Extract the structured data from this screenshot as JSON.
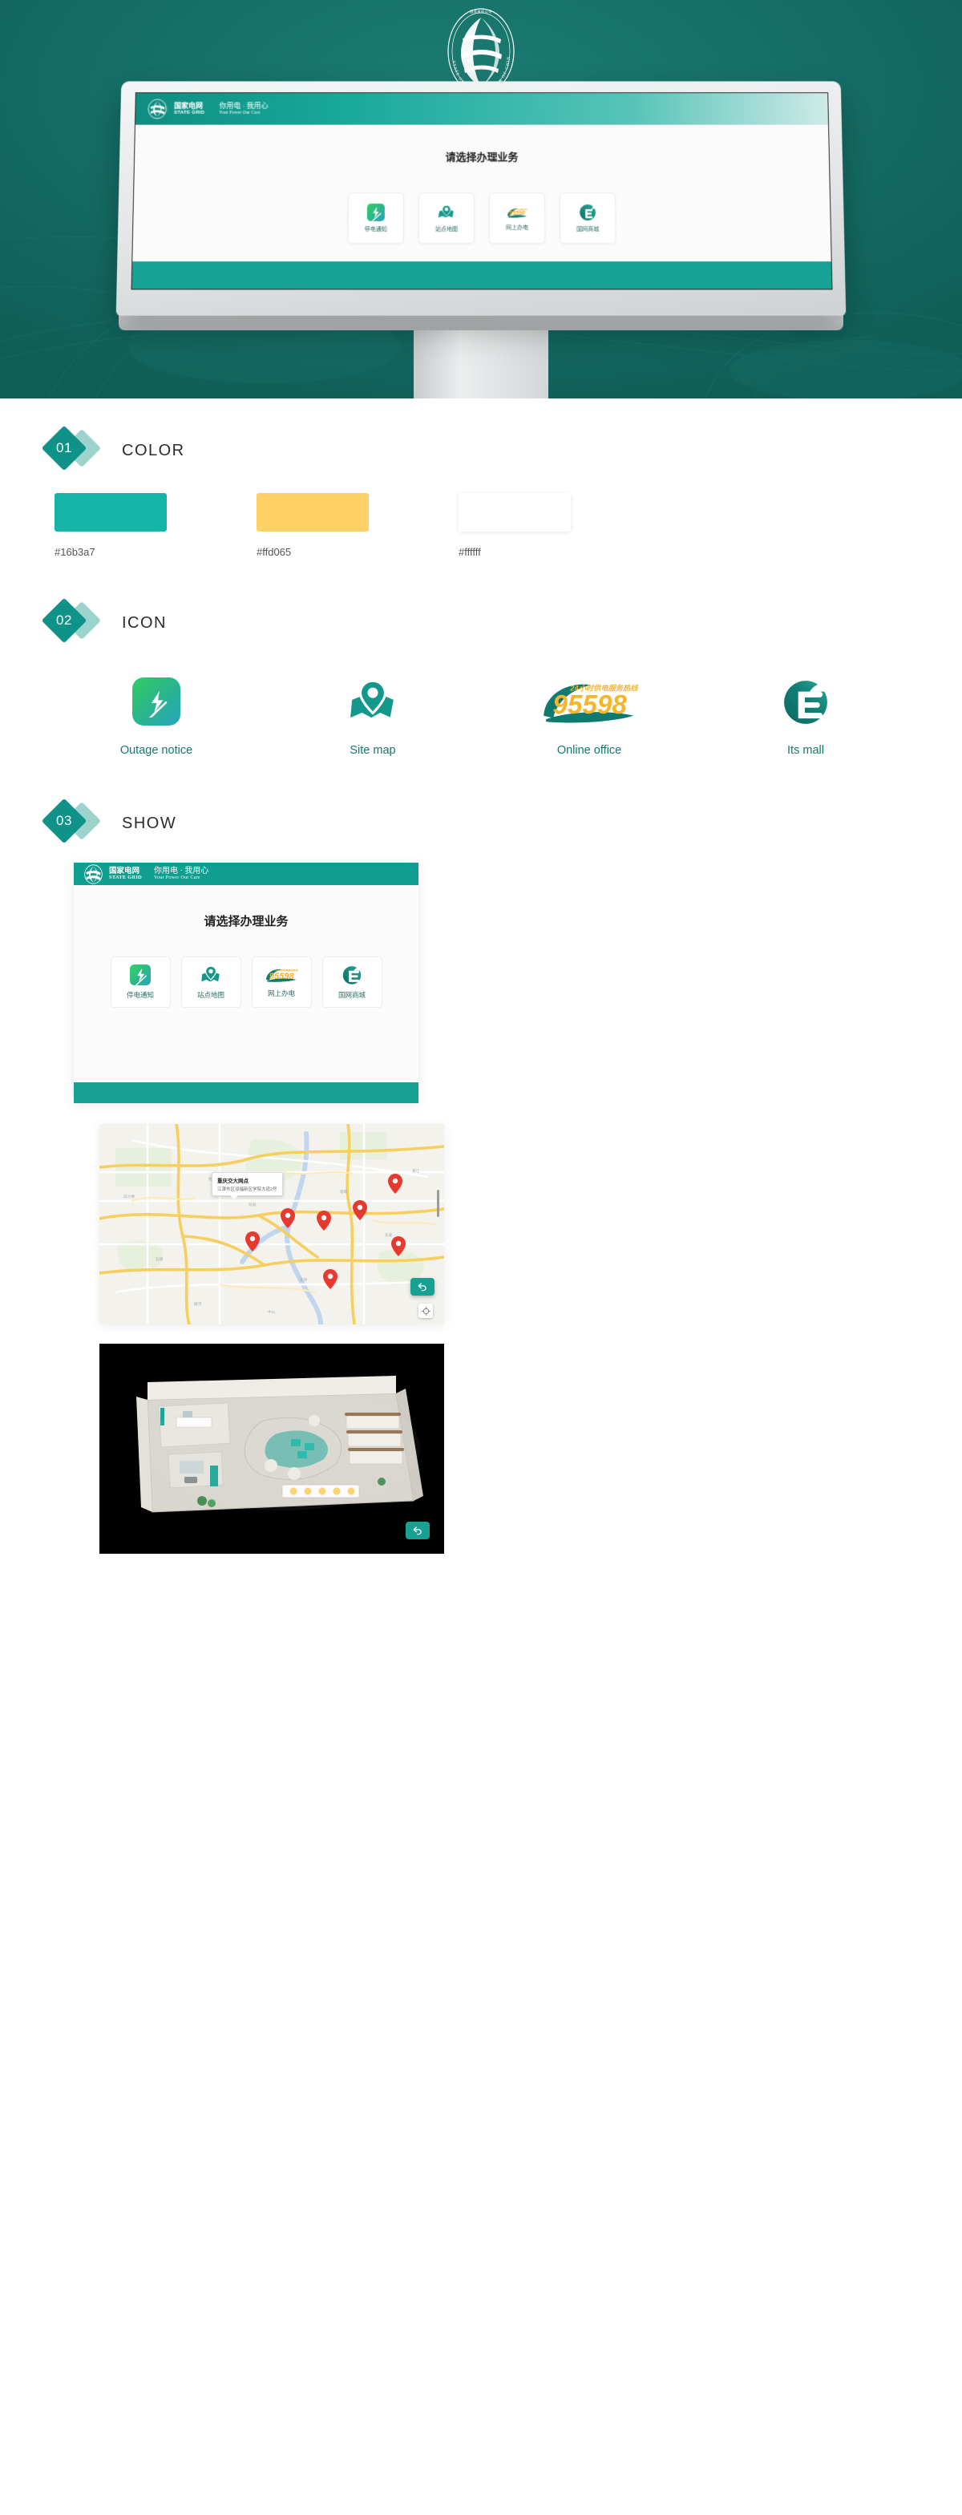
{
  "hero": {
    "brand_cn": "国家电网公司",
    "brand_en": "STATE GRID",
    "brand_en_parts": {
      "s": "S",
      "tate": "TATE",
      "g": "G",
      "rid": "RID"
    },
    "kiosk": {
      "header_cn": "国家电网",
      "header_en": "STATE GRID",
      "slogan_cn": "你用电 · 我用心",
      "slogan_en": "Your Power Our Care",
      "title": "请选择办理业务",
      "buttons": [
        {
          "label": "停电通知",
          "icon": "outage-notice-icon"
        },
        {
          "label": "站点地图",
          "icon": "site-map-icon"
        },
        {
          "label": "网上办电",
          "icon": "online-office-95598-icon"
        },
        {
          "label": "国网商城",
          "icon": "its-mall-e-icon"
        }
      ]
    }
  },
  "sections": [
    {
      "number": "01",
      "title": "COLOR"
    },
    {
      "number": "02",
      "title": "ICON"
    },
    {
      "number": "03",
      "title": "SHOW"
    }
  ],
  "color_section": {
    "swatches": [
      {
        "hex": "#16b3a7",
        "label": "#16b3a7"
      },
      {
        "hex": "#ffd065",
        "label": "#ffd065"
      },
      {
        "hex": "#ffffff",
        "label": "#ffffff"
      }
    ]
  },
  "icon_section": {
    "icons": [
      {
        "name": "outage-notice-icon",
        "label": "Outage notice"
      },
      {
        "name": "site-map-icon",
        "label": "Site map"
      },
      {
        "name": "online-office-icon",
        "label": "Online office"
      },
      {
        "name": "its-mall-icon",
        "label": "Its mall"
      }
    ],
    "hotline": {
      "number": "95598",
      "tagline": "24小时供电服务热线"
    }
  },
  "show_section": {
    "kiosk_panel": {
      "header_cn": "国家电网",
      "header_en": "STATE GRID",
      "slogan_cn": "你用电 · 我用心",
      "slogan_en": "Your Power Our Care",
      "title": "请选择办理业务",
      "buttons": [
        {
          "label": "停电通知",
          "icon": "outage-notice-icon"
        },
        {
          "label": "站点地图",
          "icon": "site-map-icon"
        },
        {
          "label": "网上办电",
          "icon": "online-office-95598-icon"
        },
        {
          "label": "国网商城",
          "icon": "its-mall-e-icon"
        }
      ]
    },
    "map_screen": {
      "callout_title": "重庆交大网点",
      "callout_address": "江津市区双福新区学院大道2号",
      "back_icon": "back-arrow-icon",
      "locate_icon": "recenter-icon",
      "marker_count": 7
    },
    "render_screen": {
      "back_icon": "back-arrow-icon",
      "caption": ""
    }
  },
  "theme": {
    "teal": "#16b3a7",
    "teal_dark": "#0f8d80",
    "yellow": "#ffd065",
    "white": "#ffffff",
    "hero_bg": "#15746c"
  }
}
